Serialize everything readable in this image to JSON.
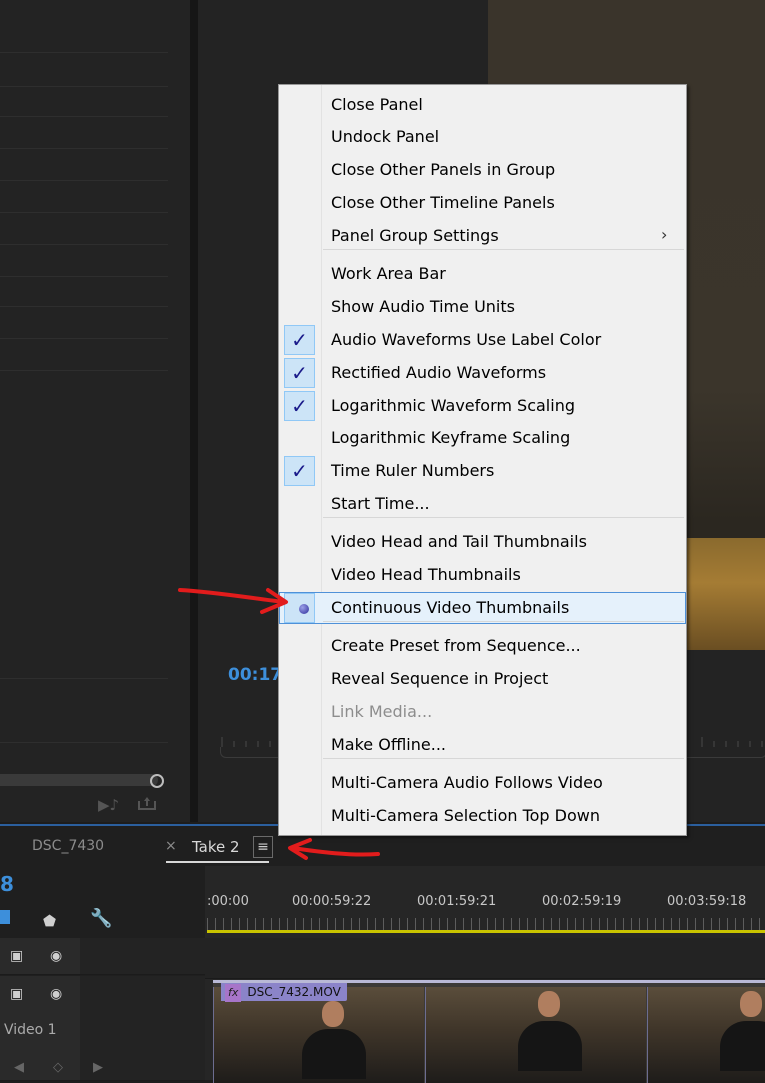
{
  "menu": {
    "items": [
      {
        "label": "Close Panel",
        "checked": false,
        "enabled": true
      },
      {
        "label": "Undock Panel",
        "checked": false,
        "enabled": true
      },
      {
        "label": "Close Other Panels in Group",
        "checked": false,
        "enabled": true
      },
      {
        "label": "Close Other Timeline Panels",
        "checked": false,
        "enabled": true
      },
      {
        "label": "Panel Group Settings",
        "checked": false,
        "enabled": true,
        "submenu": true
      },
      {
        "label": "Work Area Bar",
        "checked": false,
        "enabled": true
      },
      {
        "label": "Show Audio Time Units",
        "checked": false,
        "enabled": true
      },
      {
        "label": "Audio Waveforms Use Label Color",
        "checked": true,
        "enabled": true
      },
      {
        "label": "Rectified Audio Waveforms",
        "checked": true,
        "enabled": true
      },
      {
        "label": "Logarithmic Waveform Scaling",
        "checked": true,
        "enabled": true
      },
      {
        "label": "Logarithmic Keyframe Scaling",
        "checked": false,
        "enabled": true
      },
      {
        "label": "Time Ruler Numbers",
        "checked": true,
        "enabled": true
      },
      {
        "label": "Start Time...",
        "checked": false,
        "enabled": true
      },
      {
        "label": "Video Head and Tail Thumbnails",
        "checked": false,
        "enabled": true
      },
      {
        "label": "Video Head Thumbnails",
        "checked": false,
        "enabled": true
      },
      {
        "label": "Continuous Video Thumbnails",
        "selected": true,
        "highlighted": true,
        "enabled": true
      },
      {
        "label": "Create Preset from Sequence...",
        "checked": false,
        "enabled": true
      },
      {
        "label": "Reveal Sequence in Project",
        "checked": false,
        "enabled": true
      },
      {
        "label": "Link Media...",
        "checked": false,
        "enabled": false
      },
      {
        "label": "Make Offline...",
        "checked": false,
        "enabled": true
      },
      {
        "label": "Multi-Camera Audio Follows Video",
        "checked": false,
        "enabled": true
      },
      {
        "label": "Multi-Camera Selection Top Down",
        "checked": false,
        "enabled": true
      }
    ],
    "check_glyph": "✓",
    "submenu_glyph": "›"
  },
  "monitor": {
    "timecode": "00:17"
  },
  "timeline": {
    "tabs": [
      {
        "label": "DSC_7430",
        "active": false
      },
      {
        "label": "Take 2",
        "active": true
      }
    ],
    "close_glyph": "×",
    "menu_glyph": "≡",
    "left_number": "8",
    "ruler_labels": [
      ":00:00",
      "00:00:59:22",
      "00:01:59:21",
      "00:02:59:19",
      "00:03:59:18"
    ],
    "track_label": "Video 1",
    "clip": {
      "fx": "fx",
      "name": "DSC_7432.MOV"
    }
  },
  "icons": {
    "marker": "marker-icon",
    "wrench": "wrench-icon",
    "camera": "camera-icon",
    "eye": "eye-icon"
  },
  "colors": {
    "accent_blue": "#3d8fdb",
    "work_area_yellow": "#c9c400",
    "clip_label_purple": "#8b84c9",
    "annotation_red": "#e21c1c"
  }
}
